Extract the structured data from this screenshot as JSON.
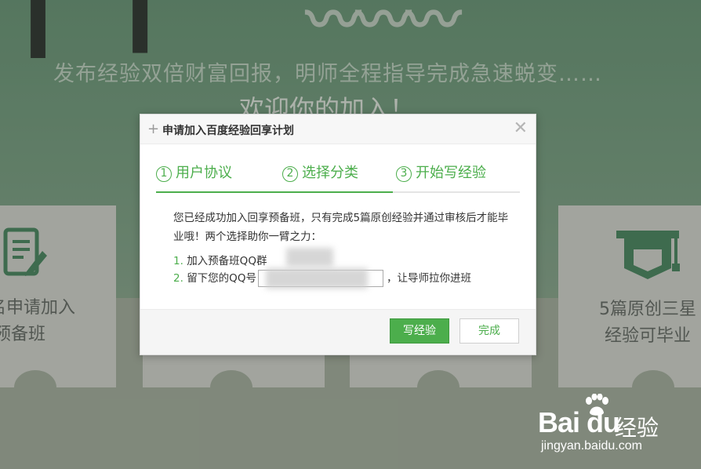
{
  "background": {
    "slogan": "发布经验双倍财富回报，明师全程指导完成急速蜕变……",
    "welcome": "欢迎你的加入！",
    "cards": [
      {
        "text_line1": "名申请加入",
        "text_line2": "预备班",
        "icon": "document-pen-icon"
      },
      {
        "text_line1": "5篇原创三星",
        "text_line2": "经验可毕业",
        "icon": "graduation-cap-icon"
      }
    ]
  },
  "dialog": {
    "title": "申请加入百度经验回享计划",
    "steps": [
      {
        "num": "1",
        "label": "用户协议"
      },
      {
        "num": "2",
        "label": "选择分类"
      },
      {
        "num": "3",
        "label": "开始写经验"
      }
    ],
    "intro": "您已经成功加入回享预备班，只有完成5篇原创经验并通过审核后才能毕业哦！两个选择助你一臂之力：",
    "options": [
      {
        "num": "1.",
        "text": "加入预备班QQ群"
      },
      {
        "num": "2.",
        "text_before": "留下您的QQ号",
        "text_after": "，让导师拉你进班"
      }
    ],
    "qq_input_value": "",
    "buttons": {
      "write": "写经验",
      "done": "完成"
    }
  },
  "watermark": {
    "logo": "Bai du",
    "product": "经验",
    "url": "jingyan.baidu.com"
  },
  "colors": {
    "accent": "#4cae4c",
    "header_bg": "#f7f7f7",
    "text": "#333333"
  }
}
